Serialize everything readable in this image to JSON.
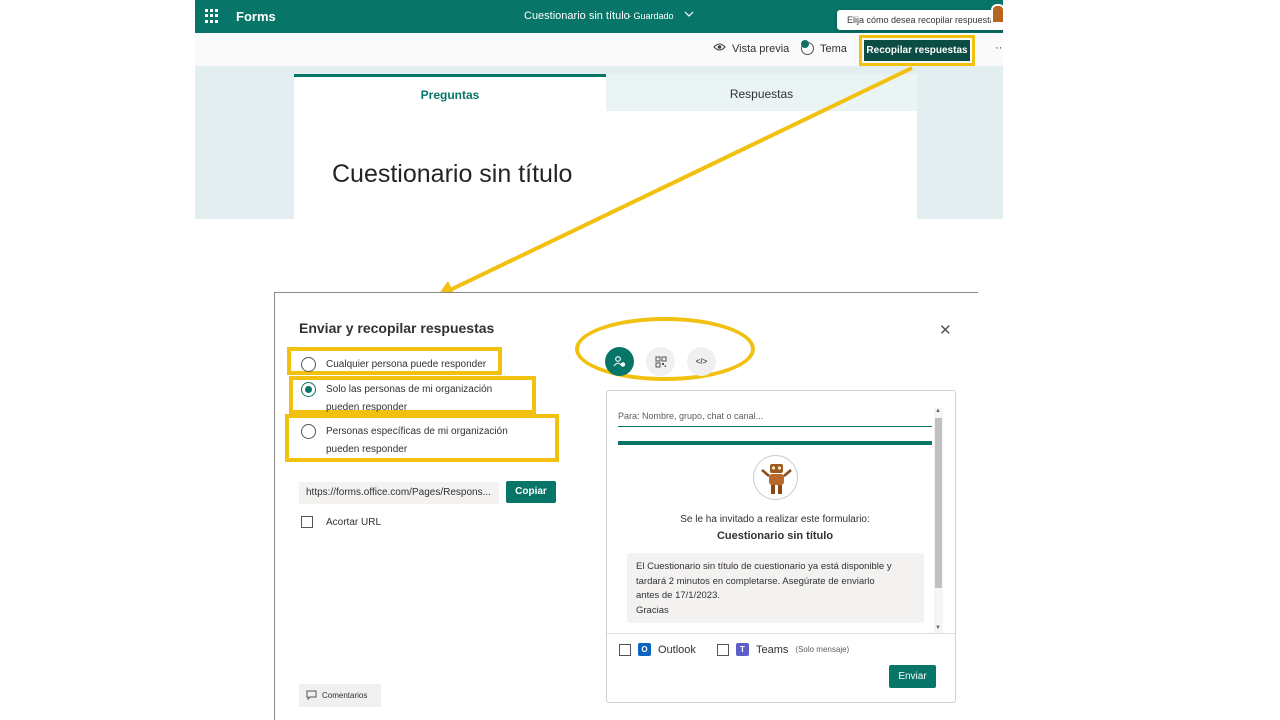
{
  "header": {
    "app_name": "Forms",
    "form_title": "Cuestionario sin título",
    "save_status": "Guardado",
    "tooltip": "Elija cómo desea recopilar respuestas"
  },
  "commandbar": {
    "preview_label": "Vista previa",
    "theme_label": "Tema",
    "collect_label": "Recopilar respuestas",
    "more_label": "···"
  },
  "tabs": {
    "questions": "Preguntas",
    "responses": "Respuestas"
  },
  "quiz_title": "Cuestionario sin título",
  "dialog": {
    "title": "Enviar y recopilar respuestas",
    "close_label": "✕",
    "options": [
      {
        "label": "Cualquier persona puede responder",
        "selected": false
      },
      {
        "label": "Solo las personas de mi organización pueden responder",
        "selected": true
      },
      {
        "label": "Personas específicas de mi organización pueden responder",
        "selected": false
      }
    ],
    "url": "https://forms.office.com/Pages/Respons...",
    "copy_label": "Copiar",
    "shorten_label": "Acortar URL",
    "comments_label": "Comentarios",
    "icon_tabs": [
      "share-people-icon",
      "qr-code-icon",
      "embed-code-icon"
    ],
    "embed_glyph": "</>"
  },
  "invite": {
    "placeholder": "Para: Nombre, grupo, chat o canal...",
    "invited_text": "Se le ha invitado a realizar este formulario:",
    "title": "Cuestionario sin título",
    "message_lines": [
      "El Cuestionario sin título de cuestionario ya está disponible y",
      "tardará 2 minutos en completarse. Asegúrate de enviarlo",
      "antes de 17/1/2023.",
      "Gracias"
    ],
    "outlook_label": "Outlook",
    "teams_label": "Teams",
    "teams_note": "(Solo mensaje)",
    "send_label": "Enviar"
  },
  "colors": {
    "accent": "#077568",
    "highlight": "#f2c00f"
  }
}
